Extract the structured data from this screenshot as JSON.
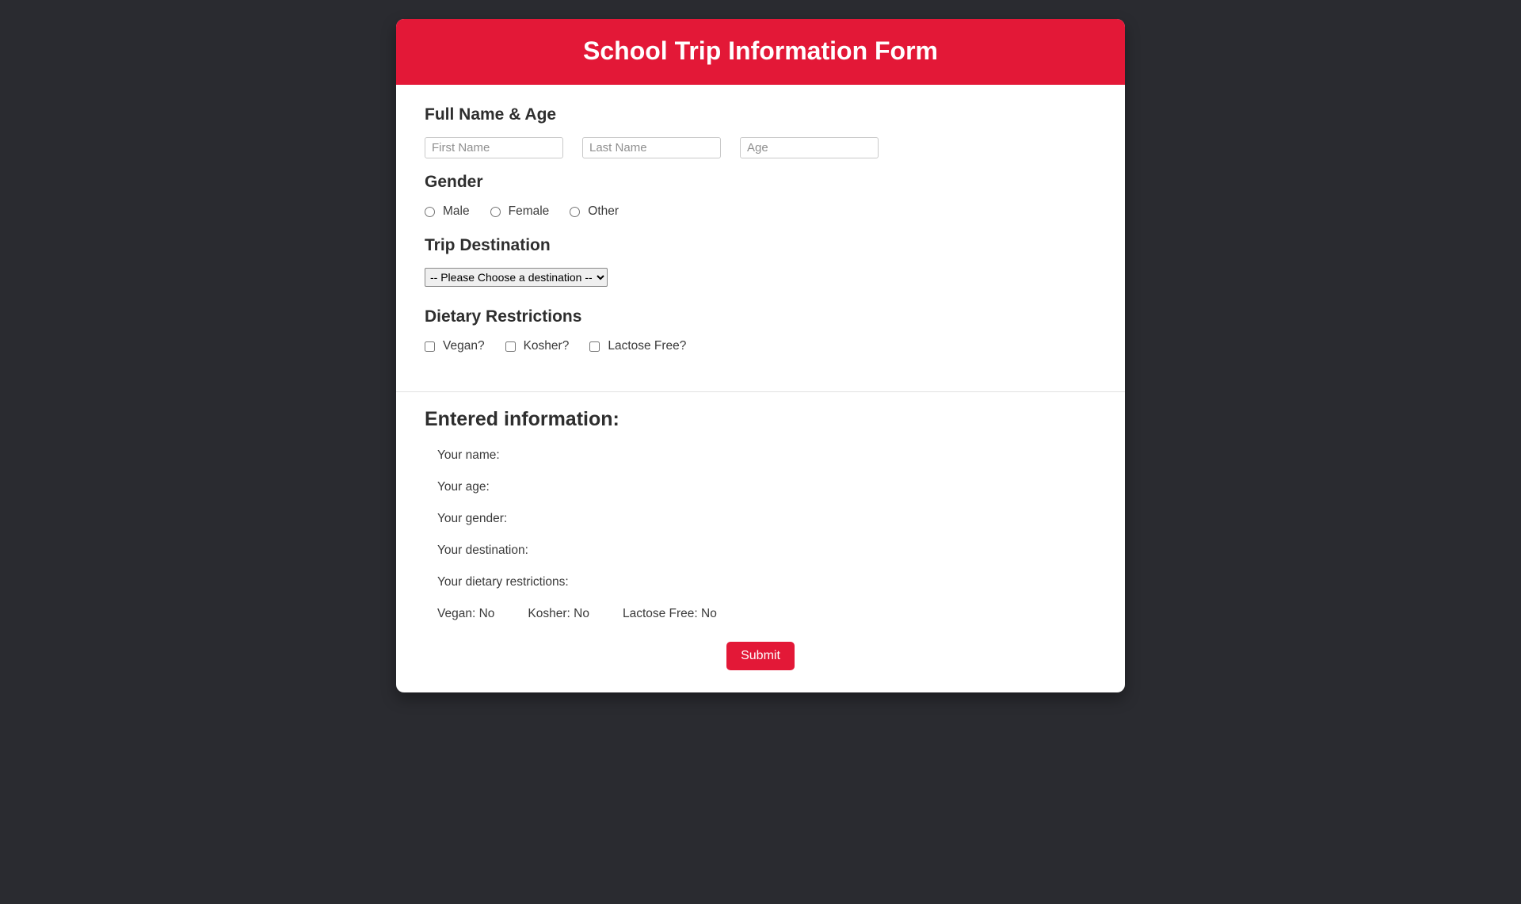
{
  "header": {
    "title": "School Trip Information Form"
  },
  "sections": {
    "name_age": {
      "title": "Full Name & Age",
      "first_name_placeholder": "First Name",
      "last_name_placeholder": "Last Name",
      "age_placeholder": "Age"
    },
    "gender": {
      "title": "Gender",
      "options": {
        "male": "Male",
        "female": "Female",
        "other": "Other"
      }
    },
    "destination": {
      "title": "Trip Destination",
      "placeholder_option": "-- Please Choose a destination --"
    },
    "dietary": {
      "title": "Dietary Restrictions",
      "vegan": "Vegan?",
      "kosher": "Kosher?",
      "lactose": "Lactose Free?"
    }
  },
  "summary": {
    "title": "Entered information:",
    "name_label": "Your name:",
    "age_label": "Your age:",
    "gender_label": "Your gender:",
    "destination_label": "Your destination:",
    "dietary_label": "Your dietary restrictions:",
    "vegan_line": "Vegan: No",
    "kosher_line": "Kosher: No",
    "lactose_line": "Lactose Free: No"
  },
  "submit_label": "Submit",
  "colors": {
    "accent": "#e31837",
    "page_bg": "#2a2b30",
    "card_bg": "#ffffff"
  }
}
